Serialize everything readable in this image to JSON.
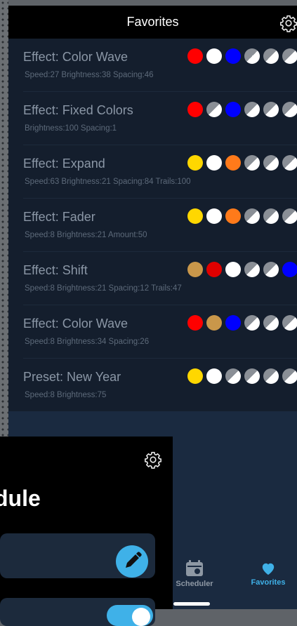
{
  "header": {
    "title": "Favorites"
  },
  "favorites": [
    {
      "title": "Effect: Color Wave",
      "subtitle": "Speed:27 Brightness:38 Spacing:46",
      "colors": [
        "#ff0000",
        "#ffffff",
        "#0000ff",
        "mixed",
        "mixed",
        "mixed"
      ]
    },
    {
      "title": "Effect: Fixed Colors",
      "subtitle": "Brightness:100 Spacing:1",
      "colors": [
        "#ff0000",
        "mixed",
        "#0000ff",
        "mixed",
        "mixed",
        "mixed"
      ]
    },
    {
      "title": "Effect: Expand",
      "subtitle": "Speed:63 Brightness:21 Spacing:84 Trails:100",
      "colors": [
        "#ffd700",
        "#ffffff",
        "#ff7a1a",
        "mixed",
        "mixed",
        "mixed"
      ]
    },
    {
      "title": "Effect: Fader",
      "subtitle": "Speed:8 Brightness:21 Amount:50",
      "colors": [
        "#ffd700",
        "#ffffff",
        "#ff7a1a",
        "mixed",
        "mixed",
        "mixed"
      ]
    },
    {
      "title": "Effect: Shift",
      "subtitle": "Speed:8 Brightness:21 Spacing:12 Trails:47",
      "colors": [
        "#c9974a",
        "#e00000",
        "#ffffff",
        "mixed",
        "mixed",
        "#0000ff"
      ]
    },
    {
      "title": "Effect: Color Wave",
      "subtitle": "Speed:8 Brightness:34 Spacing:26",
      "colors": [
        "#ff0000",
        "#c9974a",
        "#0000ff",
        "mixed",
        "mixed",
        "mixed"
      ]
    },
    {
      "title": "Preset: New Year",
      "subtitle": "Speed:8 Brightness:75",
      "colors": [
        "#ffd700",
        "#ffffff",
        "mixed",
        "mixed",
        "mixed",
        "mixed"
      ]
    }
  ],
  "tabbar": {
    "scheduler_label": "Scheduler",
    "favorites_label": "Favorites",
    "active_color": "#3fb1e8"
  },
  "scheduler_overlay": {
    "title": "dule"
  }
}
